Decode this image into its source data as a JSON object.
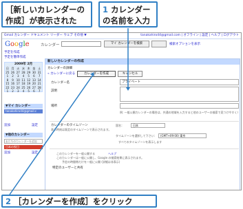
{
  "callouts": {
    "new_calendar": "［新しいカレンダーの作成］が表示された",
    "step1_num": "1",
    "step1_text": "カレンダーの名前を入力",
    "step2_num": "2",
    "step2_text": "［カレンダーを作成］をクリック"
  },
  "topbar": {
    "left": "Gmail カレンダー ドキュメント リーダー ウェブ その他 ▼",
    "right": "tanakahiro44@gmail.com | オフライン | 設定 | ヘルプ | ログアウト"
  },
  "header": {
    "logo": "Google",
    "logo_sub": "カレンダー",
    "search_button": "マイ カレンダーを検索",
    "search_options": "検索オプションを表示"
  },
  "sidebar": {
    "create_event": "予定を作成",
    "quick_add": "予定を簡単作成",
    "mini_cal_title": "2009年 2月",
    "weekdays": [
      "日",
      "月",
      "火",
      "水",
      "木",
      "金",
      "土"
    ],
    "weeks": [
      [
        "25",
        "26",
        "27",
        "28",
        "29",
        "30",
        "31"
      ],
      [
        "1",
        "2",
        "3",
        "4",
        "5",
        "6",
        "7"
      ],
      [
        "8",
        "9",
        "10",
        "11",
        "12",
        "13",
        "14"
      ],
      [
        "15",
        "16",
        "17",
        "18",
        "19",
        "20",
        "21"
      ],
      [
        "22",
        "23",
        "24",
        "25",
        "26",
        "27",
        "28"
      ],
      [
        "1",
        "2",
        "3",
        "4",
        "5",
        "6",
        "7"
      ]
    ],
    "my_calendars": "▼マイ カレンダー",
    "my_cal_item": "tanakahiro44@gmail.c",
    "my_add": "追加",
    "my_settings": "設定",
    "other_calendars": "▼他のカレンダー",
    "other_placeholder": "友だちのカレンダーを追加",
    "holiday": "日本の祝日",
    "other_add": "追加",
    "other_settings": "設定"
  },
  "main": {
    "title": "新しいカレンダーの作成",
    "subtitle": "カレンダーの詳細",
    "back_link": "« カレンダーに戻る",
    "create_button": "カレンダーを作成",
    "cancel_button": "キャンセル",
    "name_label": "カレンダー名",
    "name_value": "プライベート",
    "desc_label": "説明",
    "place_label": "場所",
    "place_hint": "例: 一般公開カレンダーの場合は、共通の地域を入力すると他のユーザーの検索で見つけやすくなります。",
    "tz_label": "カレンダーのタイムゾーン",
    "tz_note": "表示時刻は既定のタイムゾーンで表示されます。",
    "country_label": "国名：",
    "country_value": "日本",
    "tz_select_label": "タイムゾーンを選択して下さい：",
    "tz_value": "(GMT+09:00) 東京",
    "all_tz": "すべてのタイムゾーンを表示します",
    "share_label": "このカレンダーを一般公開する",
    "share_help": "ヘルプ",
    "share_note": "このカレンダーは一般に公開し、Google の検索結果に表示されます。",
    "busy_only": "予定の時間帯だけを一般に公開 (詳細は非表示)",
    "specific_users": "特定のユーザーと共有"
  }
}
